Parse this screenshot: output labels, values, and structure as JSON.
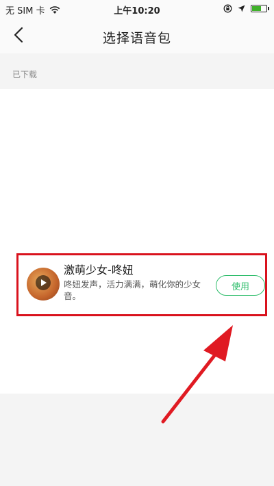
{
  "status_bar": {
    "carrier": "无 SIM 卡",
    "time": "上午10:20"
  },
  "nav": {
    "title": "选择语音包"
  },
  "section": {
    "downloaded_label": "已下载"
  },
  "voice_packs": [
    {
      "name": "激萌少女-咚妞",
      "description": "咚妞发声，活力满满，萌化你的少女音。",
      "action_label": "使用"
    }
  ],
  "colors": {
    "accent_green": "#2ebd6b",
    "highlight_red": "#d9121d"
  }
}
